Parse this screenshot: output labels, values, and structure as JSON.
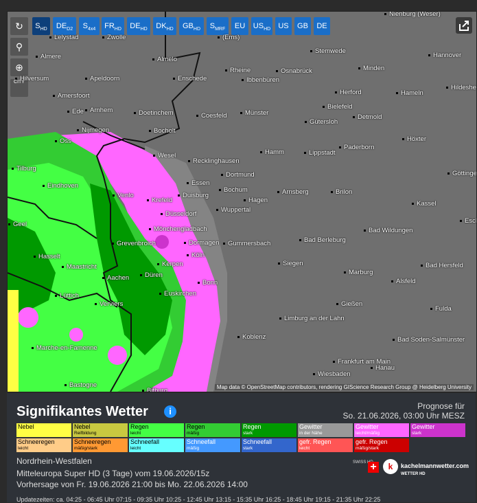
{
  "toolbar": {
    "buttons": [
      {
        "main": "S",
        "sub": "HD"
      },
      {
        "main": "DE",
        "sub": "D2"
      },
      {
        "main": "S",
        "sub": "4x4"
      },
      {
        "main": "FR",
        "sub": "HD"
      },
      {
        "main": "DE",
        "sub": "HD"
      },
      {
        "main": "DK",
        "sub": "HD"
      },
      {
        "main": "GB",
        "sub": "HD"
      },
      {
        "main": "S",
        "sub": "MRF"
      },
      {
        "main": "EU",
        "sub": ""
      },
      {
        "main": "US",
        "sub": "HD"
      },
      {
        "main": "US",
        "sub": ""
      },
      {
        "main": "GB",
        "sub": ""
      },
      {
        "main": "DE",
        "sub": ""
      }
    ],
    "reload_icon": "reload-icon",
    "locate_icon": "location-pin-icon",
    "zoom_icon": "zoom-icon",
    "city_toggle": "CITY"
  },
  "map": {
    "credit": "Map data © OpenStreetMap contributors, rendering GIScience Research Group @ Heidelberg University",
    "cities": [
      "Nienburg (Weser)",
      "Lelystad",
      "Zwolle",
      "(Ems)",
      "Stemwede",
      "Hannover",
      "Almere",
      "Almelo",
      "Rheine",
      "Osnabrück",
      "Minden",
      "Hilversum",
      "Apeldoorn",
      "Enschede",
      "Ibbenbüren",
      "Herford",
      "Hameln",
      "Hildeshe",
      "Amersfoort",
      "Bielefeld",
      "Ede",
      "Arnhem",
      "Doetinchem",
      "Coesfeld",
      "Münster",
      "Gütersloh",
      "Detmold",
      "Nijmegen",
      "Bocholt",
      "Höxter",
      "Oss",
      "Paderborn",
      "Wesel",
      "Hamm",
      "Lippstadt",
      "Recklinghausen",
      "Tilburg",
      "Dortmund",
      "Eindhoven",
      "Essen",
      "Bochum",
      "Arnsberg",
      "Brilon",
      "Göttinge",
      "Venlo",
      "Krefeld",
      "Duisburg",
      "Hagen",
      "Kassel",
      "Düsseldorf",
      "Wuppertal",
      "Eschw",
      "Geel",
      "Mönchengladbach",
      "Bad Wildungen",
      "Grevenbroich",
      "Dormagen",
      "Gummersbach",
      "Bad Berleburg",
      "Hasselt",
      "Köln",
      "Siegen",
      "Bad Hersfeld",
      "Maastricht",
      "Kerpen",
      "Marburg",
      "Aachen",
      "Düren",
      "Bonn",
      "Alsfeld",
      "Lüttich",
      "Euskirchen",
      "Verviers",
      "Gießen",
      "Fulda",
      "Limburg an der Lahn",
      "Koblenz",
      "Bad Soden-Salmünster",
      "Marche-en-Famenne",
      "Frankfurt am Main",
      "Hanau",
      "Wiesbaden",
      "Bastogne",
      "Bitburg"
    ]
  },
  "panel": {
    "title": "Signifikantes Wetter",
    "info_icon": "info-icon",
    "prognose_label": "Prognose für",
    "prognose_time": "So. 21.06.2026, 03:00 Uhr MESZ",
    "legend": [
      {
        "name": "Nebel",
        "sub": "",
        "color": "#ffff44"
      },
      {
        "name": "Nebel",
        "sub": "Reifbildung",
        "color": "#c8c840"
      },
      {
        "name": "Regen",
        "sub": "leicht",
        "color": "#44ff44"
      },
      {
        "name": "Regen",
        "sub": "mäßig",
        "color": "#33cc33"
      },
      {
        "name": "Regen",
        "sub": "stark",
        "color": "#009900"
      },
      {
        "name": "Gewitter",
        "sub": "in der Nähe",
        "color": "#999999"
      },
      {
        "name": "Gewitter",
        "sub": "leicht/mäßig",
        "color": "#ff66ff"
      },
      {
        "name": "Gewitter",
        "sub": "stark",
        "color": "#cc33cc"
      },
      {
        "name": "Schneeregen",
        "sub": "leicht",
        "color": "#ffcc88"
      },
      {
        "name": "Schneeregen",
        "sub": "mäßig/stark",
        "color": "#ff9933"
      },
      {
        "name": "Schneefall",
        "sub": "leicht",
        "color": "#66ffff"
      },
      {
        "name": "Schneefall",
        "sub": "mäßig",
        "color": "#4499ff"
      },
      {
        "name": "Schneefall",
        "sub": "stark",
        "color": "#3366cc"
      },
      {
        "name": "gefr. Regen",
        "sub": "leicht",
        "color": "#ff5555"
      },
      {
        "name": "gefr. Regen",
        "sub": "mäßig/stark",
        "color": "#cc0000"
      }
    ],
    "region": "Nordrhein-Westfalen",
    "model": "Mitteleuropa Super HD (3 Tage) vom 19.06.2026/15z",
    "vorhersage": "Vorhersage von Fr. 19.06.2026 21:00 bis Mo. 22.06.2026 14:00",
    "footer_partial": "Updatezeiten: ca. 04:25 - 06:45 Uhr 07:15 - 09:35 Uhr 10:25 - 12:45 Uhr 13:15 - 15:35 Uhr 16:25 - 18:45 Uhr 19:15 - 21:35 Uhr 22:25",
    "brand": "kachelmannwetter.com",
    "brand_sub": "WETTER HD",
    "swiss_label": "SWISS HD"
  }
}
